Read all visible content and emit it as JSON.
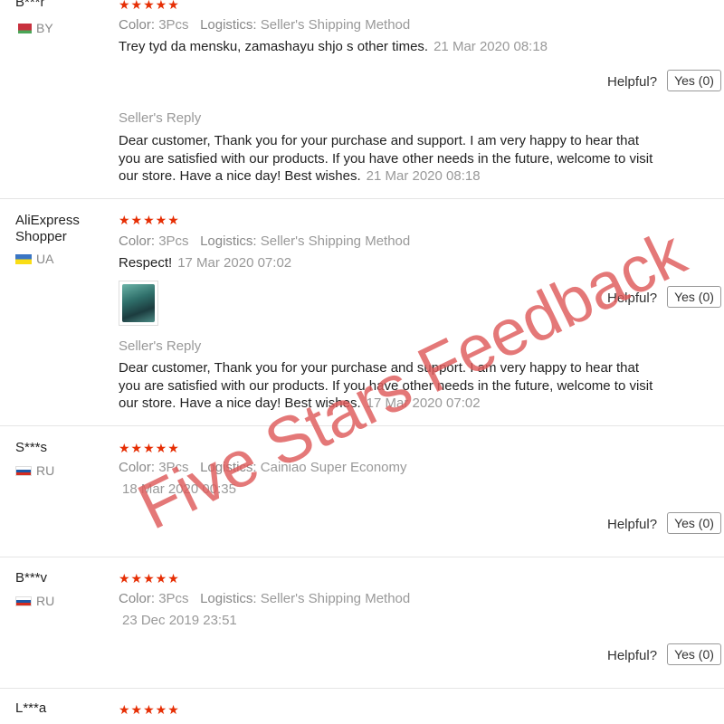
{
  "reviews": [
    {
      "user": "B***r",
      "country": "BY",
      "stars": "★★★★★",
      "color_label": "Color:",
      "color_value": "3Pcs",
      "logistics_label": "Logistics:",
      "logistics_value": "Seller's Shipping Method",
      "text": "Trey tyd da mensku, zamashayu shjo s other times.",
      "date": "21 Mar 2020 08:18",
      "helpful_label": "Helpful?",
      "yes_label": "Yes (0)",
      "reply_title": "Seller's Reply",
      "reply_lines": [
        "Dear customer, Thank you for your purchase and support. I am very happy to hear that",
        "you are satisfied with our products. If you have other needs in the future, welcome to visit",
        "our store. Have a nice day! Best wishes."
      ],
      "reply_date": "21 Mar 2020 08:18"
    },
    {
      "user": "AliExpress Shopper",
      "country": "UA",
      "stars": "★★★★★",
      "color_label": "Color:",
      "color_value": "3Pcs",
      "logistics_label": "Logistics:",
      "logistics_value": "Seller's Shipping Method",
      "text": "Respect!",
      "date": "17 Mar 2020 07:02",
      "helpful_label": "Helpful?",
      "yes_label": "Yes (0)",
      "reply_title": "Seller's Reply",
      "reply_lines": [
        "Dear customer, Thank you for your purchase and support. I am very happy to hear that",
        "you are satisfied with our products. If you have other needs in the future, welcome to visit",
        "our store. Have a nice day! Best wishes."
      ],
      "reply_date": "17 Mar 2020 07:02"
    },
    {
      "user": "S***s",
      "country": "RU",
      "stars": "★★★★★",
      "color_label": "Color:",
      "color_value": "3Pcs",
      "logistics_label": "Logistics:",
      "logistics_value": "Cainiao Super Economy",
      "date": "18 Mar 2020 00:35",
      "helpful_label": "Helpful?",
      "yes_label": "Yes (0)"
    },
    {
      "user": "B***v",
      "country": "RU",
      "stars": "★★★★★",
      "color_label": "Color:",
      "color_value": "3Pcs",
      "logistics_label": "Logistics:",
      "logistics_value": "Seller's Shipping Method",
      "date": "23 Dec 2019 23:51",
      "helpful_label": "Helpful?",
      "yes_label": "Yes (0)"
    },
    {
      "user": "L***a",
      "stars": "★★★★★"
    }
  ],
  "watermark": "Five Stars Feedback",
  "colors": {
    "stars": "#e62e04",
    "watermark": "#de5a5a",
    "muted": "#999999"
  },
  "icons": {
    "flag_by": "belarus-flag-icon",
    "flag_ua": "ukraine-flag-icon",
    "flag_ru": "russia-flag-icon"
  }
}
